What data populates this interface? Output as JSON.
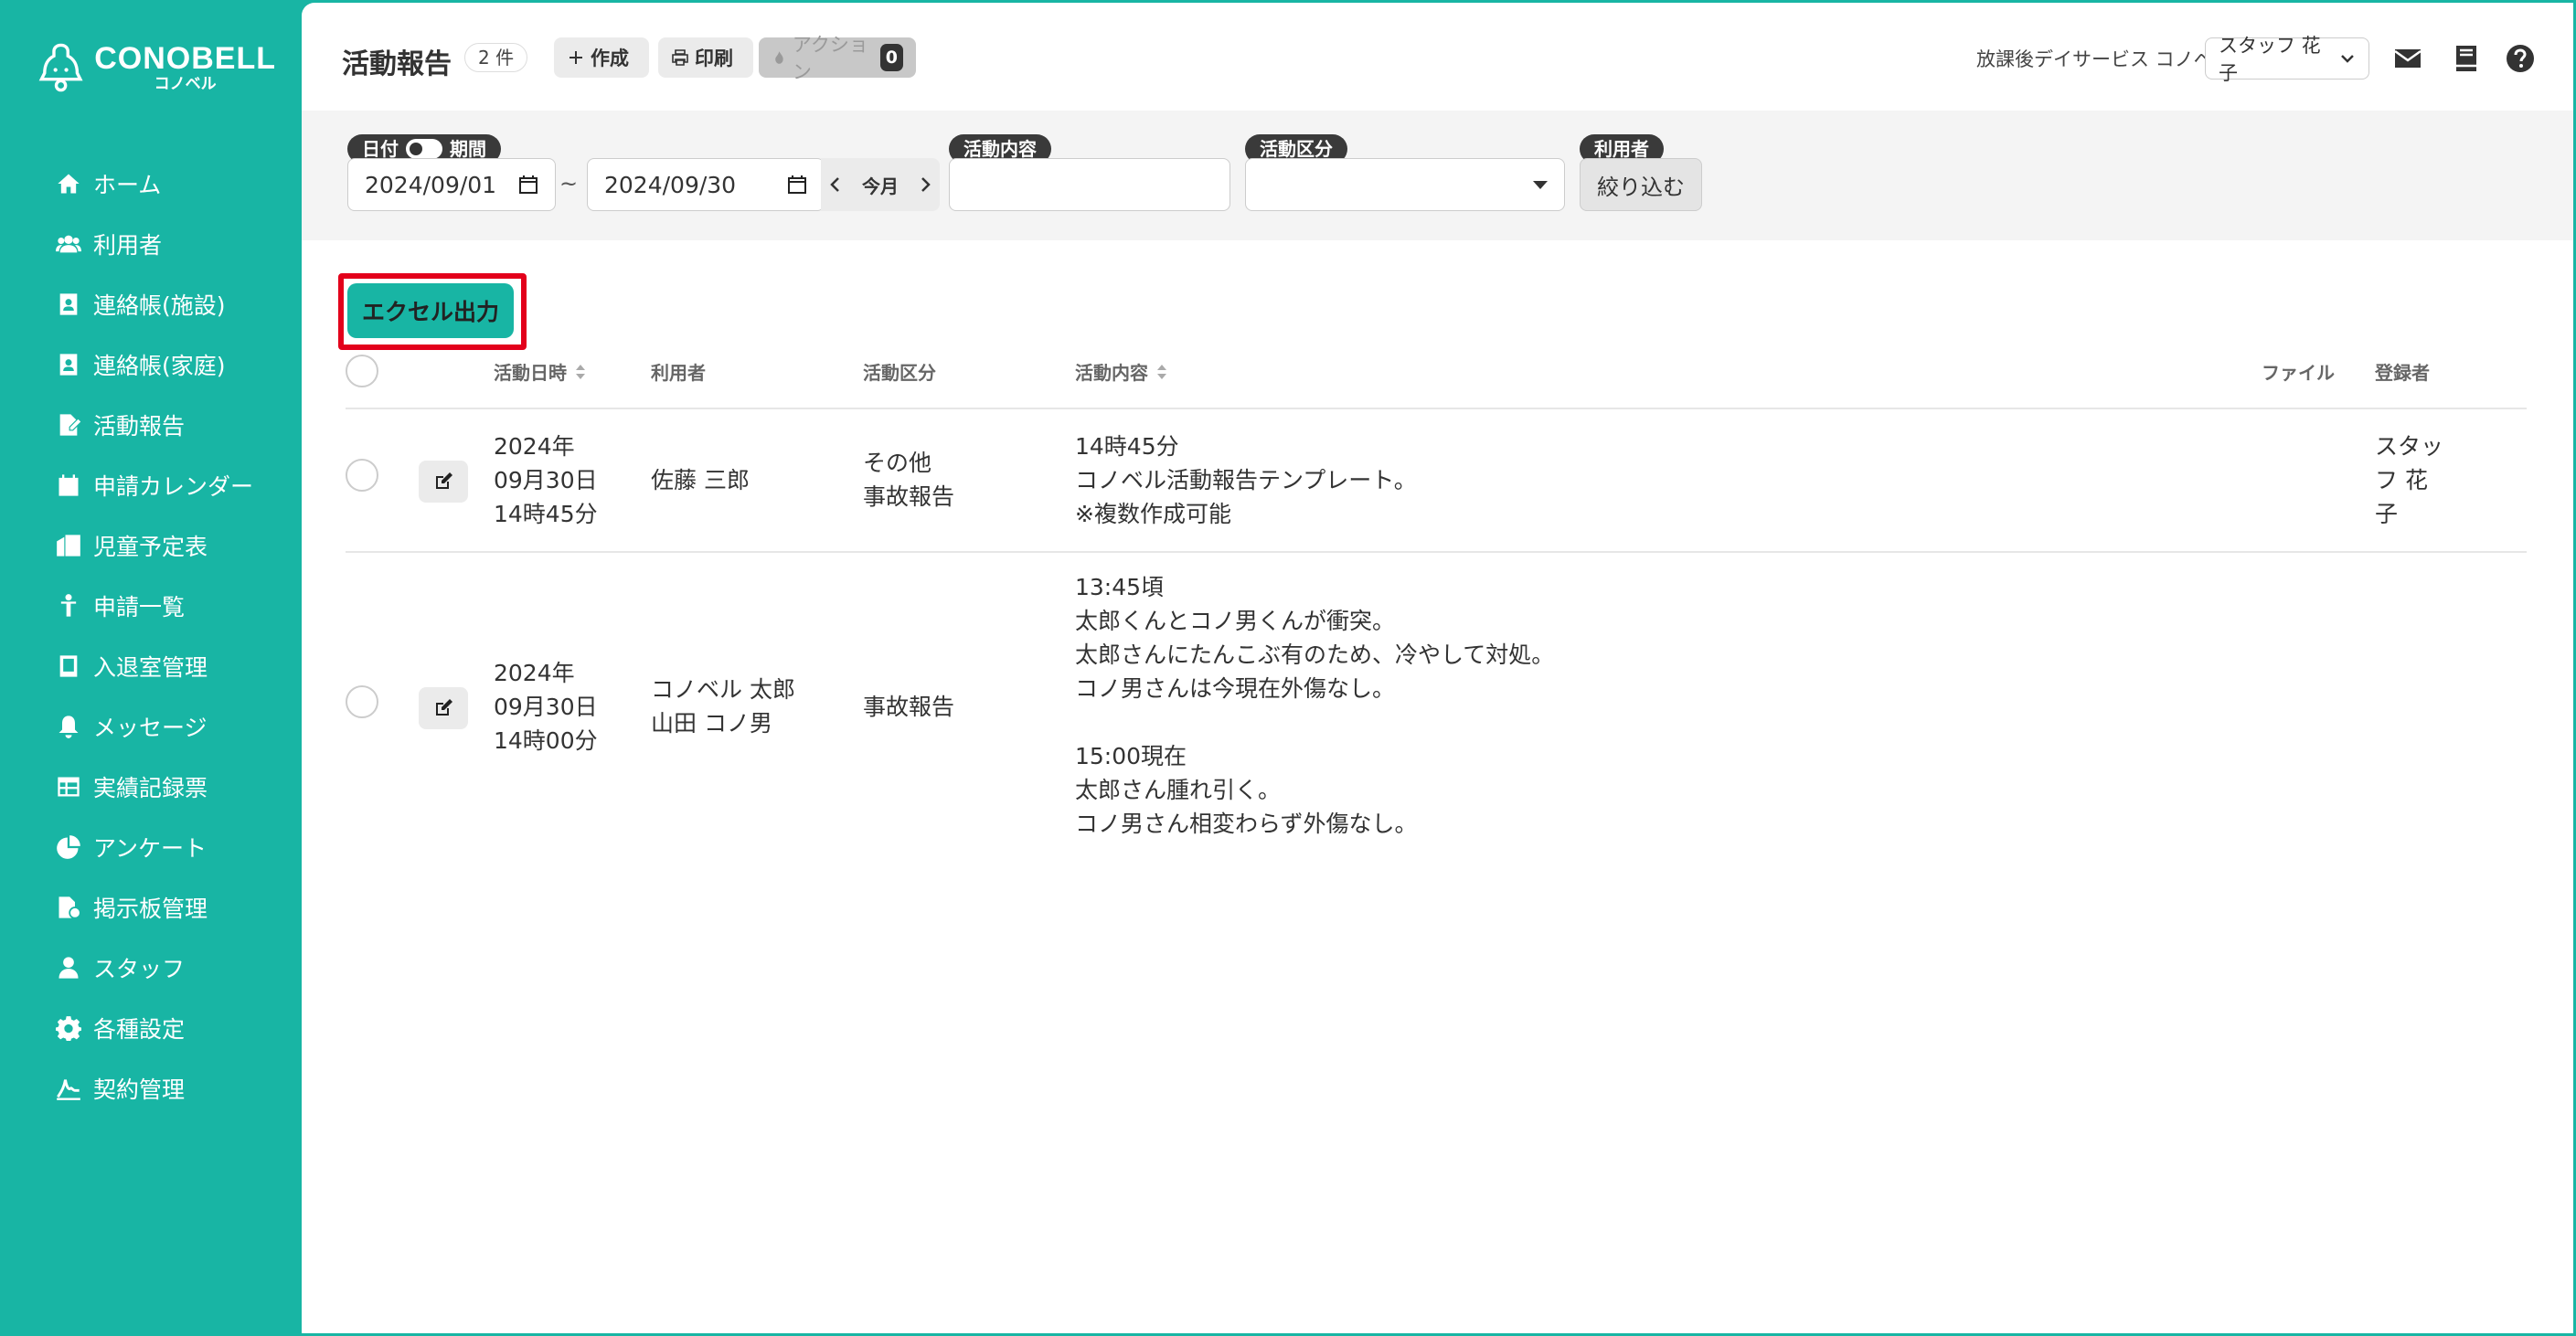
{
  "app": {
    "logo_main": "CONOBELL",
    "logo_sub": "コノベル"
  },
  "sidebar": {
    "items": [
      {
        "label": "ホーム",
        "icon": "home-icon"
      },
      {
        "label": "利用者",
        "icon": "users-icon"
      },
      {
        "label": "連絡帳(施設)",
        "icon": "contact-book-icon"
      },
      {
        "label": "連絡帳(家庭)",
        "icon": "contact-book-icon"
      },
      {
        "label": "活動報告",
        "icon": "report-icon"
      },
      {
        "label": "申請カレンダー",
        "icon": "calendar-icon"
      },
      {
        "label": "児童予定表",
        "icon": "schedule-icon"
      },
      {
        "label": "申請一覧",
        "icon": "child-icon"
      },
      {
        "label": "入退室管理",
        "icon": "tablet-icon"
      },
      {
        "label": "メッセージ",
        "icon": "bell-icon"
      },
      {
        "label": "実績記録票",
        "icon": "table-icon"
      },
      {
        "label": "アンケート",
        "icon": "pie-chart-icon"
      },
      {
        "label": "掲示板管理",
        "icon": "board-icon"
      },
      {
        "label": "スタッフ",
        "icon": "staff-icon"
      },
      {
        "label": "各種設定",
        "icon": "gear-icon"
      },
      {
        "label": "契約管理",
        "icon": "contract-icon"
      }
    ]
  },
  "header": {
    "title": "活動報告",
    "count": "2 件",
    "create_label": "作成",
    "print_label": "印刷",
    "action_label": "アクション",
    "action_count": "0",
    "facility": "放課後デイサービス コノベル",
    "staff": "スタッフ 花子"
  },
  "filters": {
    "date_label": "日付",
    "period_label": "期間",
    "date_from": "2024/09/01",
    "date_to": "2024/09/30",
    "tilde": "~",
    "this_month": "今月",
    "activity_label": "活動内容",
    "activity_value": "",
    "category_label": "活動区分",
    "category_value": "",
    "user_label": "利用者",
    "filter_button": "絞り込む"
  },
  "excel_button": "エクセル出力",
  "table": {
    "headers": {
      "datetime": "活動日時",
      "user": "利用者",
      "category": "活動区分",
      "content": "活動内容",
      "file": "ファイル",
      "registrant": "登録者"
    },
    "rows": [
      {
        "datetime": "2024年\n09月30日\n14時45分",
        "user": "佐藤 三郎",
        "category": "その他\n事故報告",
        "content": "14時45分\nコノベル活動報告テンプレート。\n※複数作成可能",
        "file": "",
        "registrant": "スタッ\nフ 花\n子"
      },
      {
        "datetime": "2024年\n09月30日\n14時00分",
        "user": "コノベル 太郎\n山田 コノ男",
        "category": "事故報告",
        "content": "13:45頃\n太郎くんとコノ男くんが衝突。\n太郎さんにたんこぶ有のため、冷やして対処。\nコノ男さんは今現在外傷なし。\n\n15:00現在\n太郎さん腫れ引く。\nコノ男さん相変わらず外傷なし。",
        "file": "",
        "registrant": ""
      }
    ]
  },
  "colors": {
    "brand": "#18b5a4",
    "highlight": "#e3001b",
    "dark_label": "#3a3a3a"
  }
}
